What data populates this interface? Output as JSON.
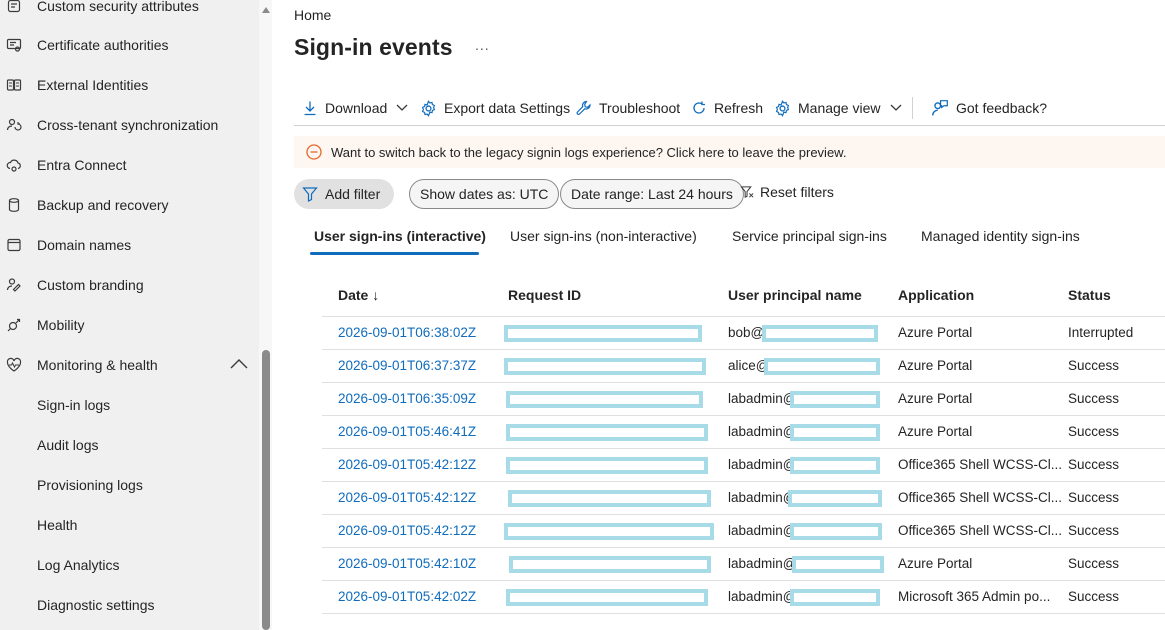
{
  "sidebar": {
    "items": [
      {
        "label": "Custom security attributes",
        "icon": "security-attributes-icon"
      },
      {
        "label": "Certificate authorities",
        "icon": "certificate-icon"
      },
      {
        "label": "External Identities",
        "icon": "external-identities-icon"
      },
      {
        "label": "Cross-tenant synchronization",
        "icon": "sync-users-icon"
      },
      {
        "label": "Entra Connect",
        "icon": "cloud-connect-icon"
      },
      {
        "label": "Backup and recovery",
        "icon": "database-icon"
      },
      {
        "label": "Domain names",
        "icon": "domain-icon"
      },
      {
        "label": "Custom branding",
        "icon": "branding-icon"
      },
      {
        "label": "Mobility",
        "icon": "mobility-icon"
      },
      {
        "label": "Monitoring & health",
        "icon": "heart-pulse-icon"
      },
      {
        "label": "Sign-in logs"
      },
      {
        "label": "Audit logs"
      },
      {
        "label": "Provisioning logs"
      },
      {
        "label": "Health"
      },
      {
        "label": "Log Analytics"
      },
      {
        "label": "Diagnostic settings"
      }
    ]
  },
  "breadcrumb": "Home",
  "page_title": "Sign-in events",
  "more": "...",
  "toolbar": {
    "download": "Download",
    "export": "Export data Settings",
    "troubleshoot": "Troubleshoot",
    "refresh": "Refresh",
    "manage_view": "Manage view",
    "feedback": "Got feedback?"
  },
  "banner": {
    "text": "Want to switch back to the legacy signin logs experience? Click here to leave the preview."
  },
  "filters": {
    "add": "Add filter",
    "dates": "Show dates as: UTC",
    "range": "Date range: Last 24 hours",
    "reset": "Reset filters"
  },
  "tabs": [
    "User sign-ins (interactive)",
    "User sign-ins (non-interactive)",
    "Service principal sign-ins",
    "Managed identity sign-ins"
  ],
  "table": {
    "columns": [
      "Date ↓",
      "Request ID",
      "User principal name",
      "Application",
      "Status"
    ],
    "rows": [
      {
        "date": "2026-09-01T06:38:02Z",
        "upn": "bob@",
        "app": "Azure Portal",
        "status": "Interrupted"
      },
      {
        "date": "2026-09-01T06:37:37Z",
        "upn": "alice@",
        "app": "Azure Portal",
        "status": "Success"
      },
      {
        "date": "2026-09-01T06:35:09Z",
        "upn": "labadmin@",
        "app": "Azure Portal",
        "status": "Success"
      },
      {
        "date": "2026-09-01T05:46:41Z",
        "upn": "labadmin@",
        "app": "Azure Portal",
        "status": "Success"
      },
      {
        "date": "2026-09-01T05:42:12Z",
        "upn": "labadmin@",
        "app": "Office365 Shell WCSS-Cl...",
        "status": "Success"
      },
      {
        "date": "2026-09-01T05:42:12Z",
        "upn": "labadmin@",
        "app": "Office365 Shell WCSS-Cl...",
        "status": "Success"
      },
      {
        "date": "2026-09-01T05:42:12Z",
        "upn": "labadmin@",
        "app": "Office365 Shell WCSS-Cl...",
        "status": "Success"
      },
      {
        "date": "2026-09-01T05:42:10Z",
        "upn": "labadmin@",
        "app": "Azure Portal",
        "status": "Success"
      },
      {
        "date": "2026-09-01T05:42:02Z",
        "upn": "labadmin@",
        "app": "Microsoft 365 Admin po...",
        "status": "Success"
      }
    ]
  },
  "colors": {
    "accent": "#0f6cbd",
    "redaction": "#a7dbe8",
    "banner_bg": "#fdf6f1",
    "banner_icon": "#e3682c"
  }
}
